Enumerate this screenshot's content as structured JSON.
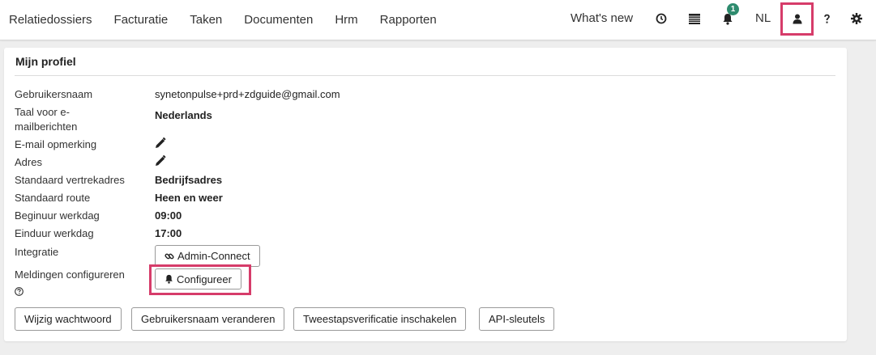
{
  "nav": {
    "items": [
      "Relatiedossiers",
      "Facturatie",
      "Taken",
      "Documenten",
      "Hrm",
      "Rapporten"
    ],
    "whats_new": "What's new",
    "notification_count": "1",
    "language": "NL",
    "icons": [
      "clock-icon",
      "list-icon",
      "bell-icon",
      "user-icon",
      "help-icon",
      "gear-icon"
    ]
  },
  "profile": {
    "title": "Mijn profiel",
    "fields": {
      "username_label": "Gebruikersnaam",
      "username_value": "synetonpulse+prd+zdguide@gmail.com",
      "email_lang_label_1": "Taal voor e-",
      "email_lang_label_2": "mailberichten",
      "email_lang_value": "Nederlands",
      "email_note_label": "E-mail opmerking",
      "address_label": "Adres",
      "departure_label": "Standaard vertrekadres",
      "departure_value": "Bedrijfsadres",
      "route_label": "Standaard route",
      "route_value": "Heen en weer",
      "start_label": "Beginuur werkdag",
      "start_value": "09:00",
      "end_label": "Einduur werkdag",
      "end_value": "17:00",
      "integration_label": "Integratie",
      "integration_button": "Admin-Connect",
      "notifications_label": "Meldingen configureren",
      "notifications_button": "Configureer"
    },
    "actions": {
      "change_password": "Wijzig wachtwoord",
      "change_username": "Gebruikersnaam veranderen",
      "two_factor": "Tweestapsverificatie inschakelen",
      "api_keys": "API-sleutels"
    }
  },
  "colors": {
    "highlight": "#d63c6a",
    "badge": "#2e8b6e"
  }
}
